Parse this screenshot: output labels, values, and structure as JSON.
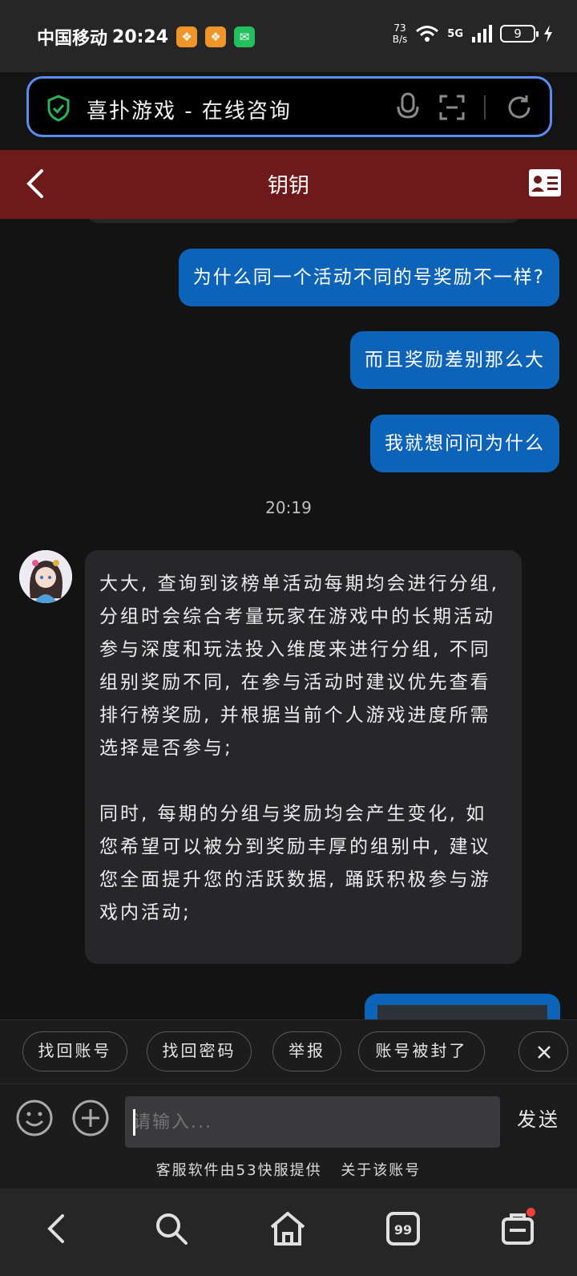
{
  "status_bar": {
    "carrier": "中国移动",
    "time": "20:24",
    "net_speed_value": "73",
    "net_speed_unit": "B/s",
    "network": "5G",
    "battery": "9"
  },
  "url_bar": {
    "title": "喜扑游戏 - 在线咨询"
  },
  "header": {
    "title": "钥钥"
  },
  "messages": {
    "out_1": "为什么同一个活动不同的号奖励不一样?",
    "out_2": "而且奖励差别那么大",
    "out_3": "我就想问问为什么",
    "timestamp": "20:19",
    "in_1_p1": "大大, 查询到该榜单活动每期均会进行分组, 分组时会综合考量玩家在游戏中的长期活动参与深度和玩法投入维度来进行分组, 不同组别奖励不同, 在参与活动时建议优先查看排行榜奖励, 并根据当前个人游戏进度所需选择是否参与;",
    "in_1_p2": "同时, 每期的分组与奖励均会产生变化, 如您希望可以被分到奖励丰厚的组别中, 建议您全面提升您的活跃数据, 踊跃积极参与游戏内活动;"
  },
  "quick_replies": [
    "找回账号",
    "找回密码",
    "举报",
    "账号被封了"
  ],
  "input": {
    "placeholder": "请输入...",
    "send_label": "发送"
  },
  "footer": {
    "provider": "客服软件由53快服提供",
    "about": "关于该账号"
  },
  "colors": {
    "header_bg": "#6f1a1a",
    "bubble_out": "#0d63b8",
    "bubble_in": "#272729",
    "url_border": "#5b8df0",
    "badge": "#f5413a"
  }
}
